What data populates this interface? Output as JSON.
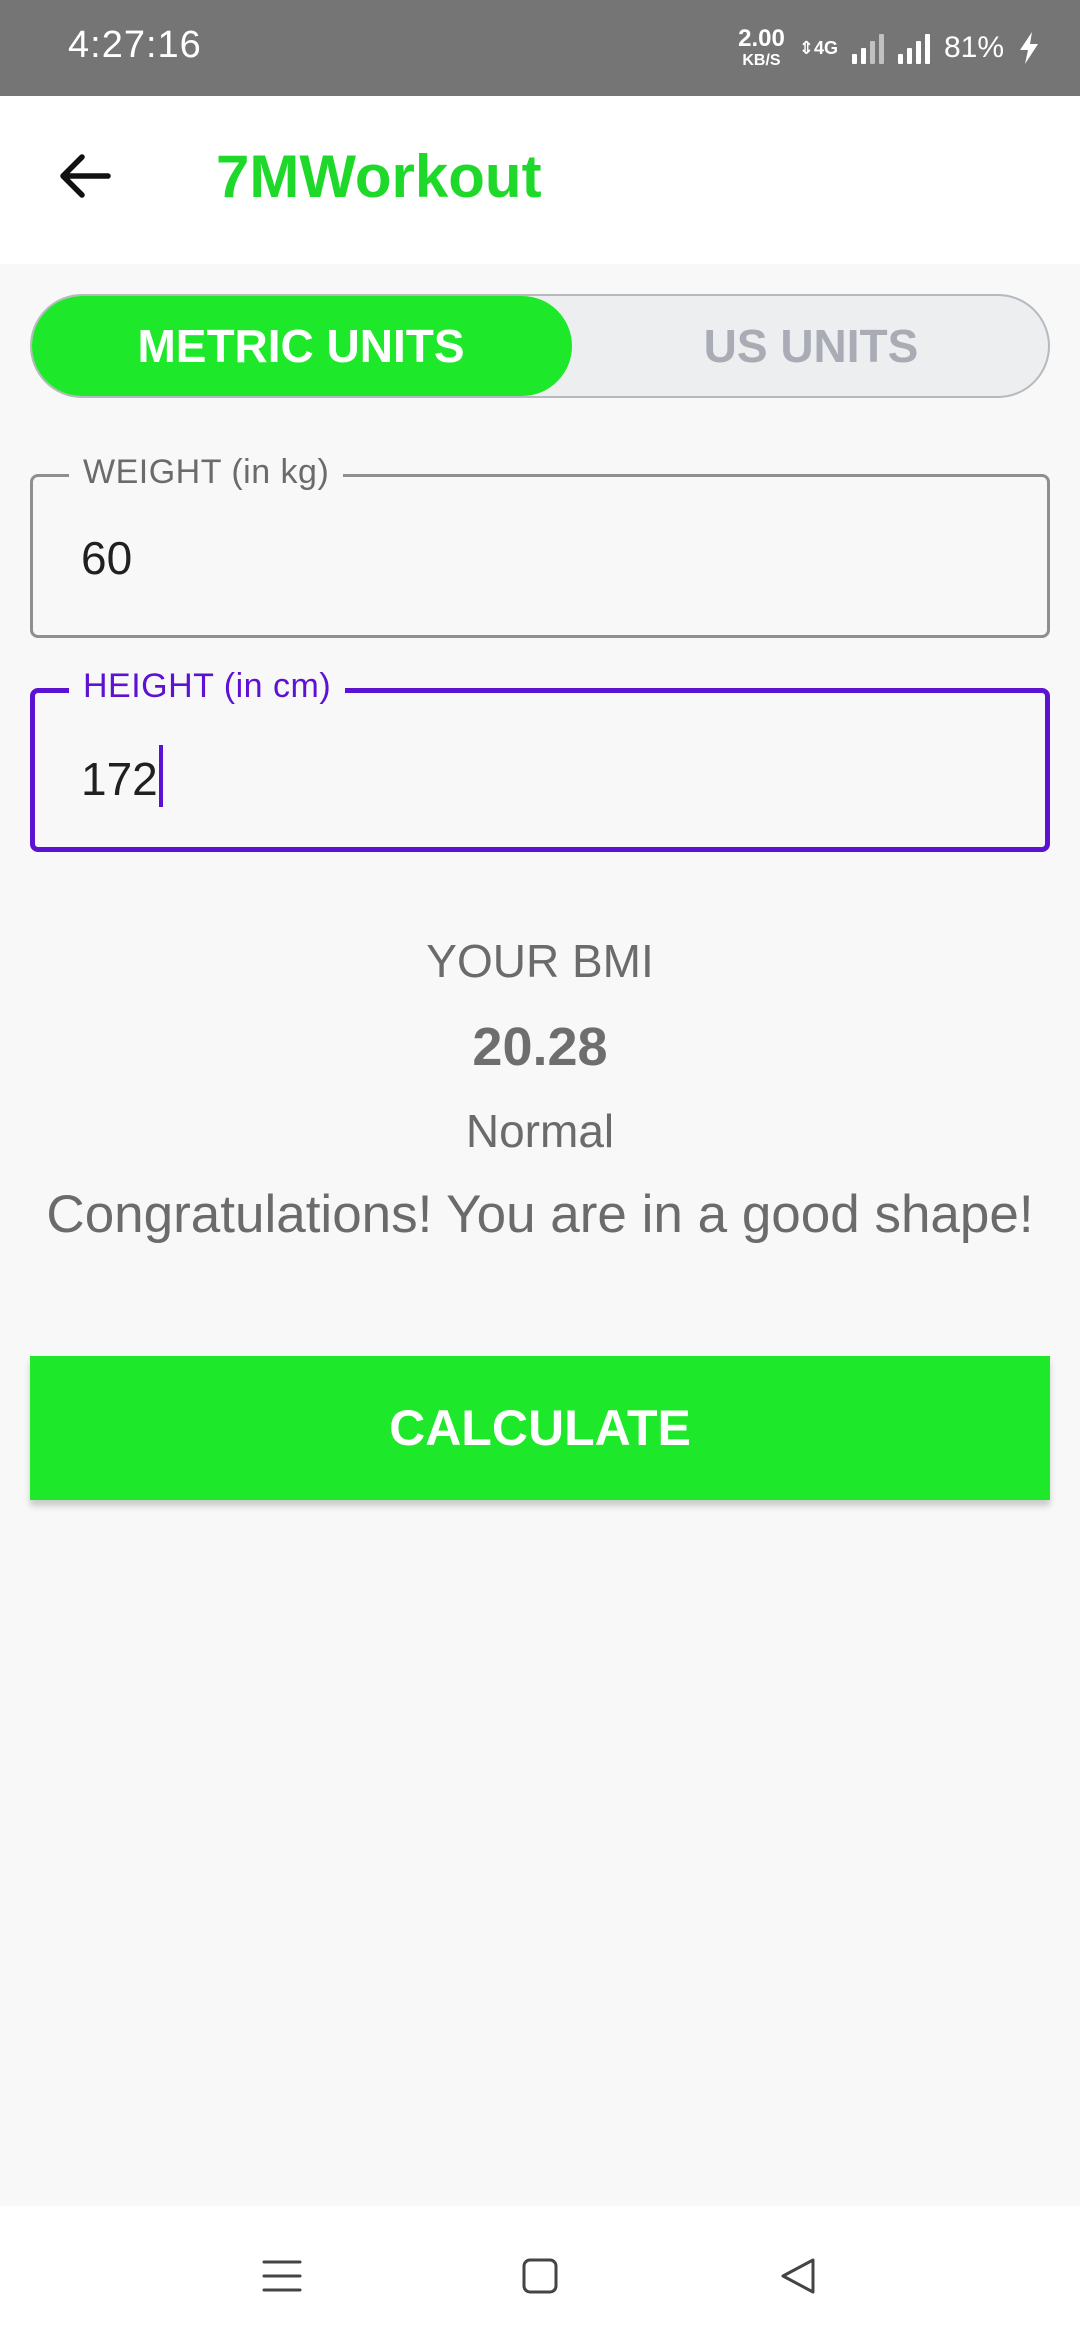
{
  "status_bar": {
    "time": "4:27:16",
    "net_speed_value": "2.00",
    "net_speed_unit": "KB/S",
    "network_type": "4G",
    "battery": "81%"
  },
  "app_bar": {
    "title": "7MWorkout",
    "title_color": "#1ed82a",
    "back_icon": "arrow-left-icon"
  },
  "units_toggle": {
    "options": [
      "METRIC UNITS",
      "US UNITS"
    ],
    "selected": "METRIC UNITS",
    "accent_color": "#1ee82a"
  },
  "weight_field": {
    "label": "WEIGHT (in kg)",
    "value": "60"
  },
  "height_field": {
    "label": "HEIGHT (in cm)",
    "value": "172",
    "focused": true,
    "focus_color": "#5d12d2"
  },
  "result": {
    "label": "YOUR BMI",
    "value": "20.28",
    "type": "Normal",
    "description": "Congratulations! You are in a good shape!"
  },
  "calculate_button": {
    "label": "CALCULATE"
  },
  "nav_bar": {
    "items": [
      "menu-icon",
      "home-square-icon",
      "back-triangle-icon"
    ]
  }
}
